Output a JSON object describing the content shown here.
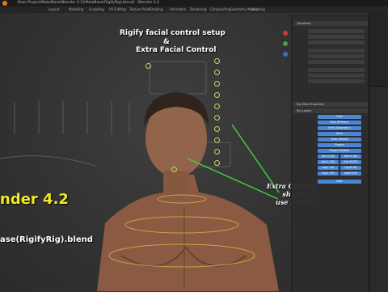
{
  "window": {
    "title": "Base Project/Male/Base(Blender 4.2)(MaleBase(RigifyRig).blend) - Blender 4.2"
  },
  "menu": {
    "items": [
      "Layout",
      "Modeling",
      "Sculpting",
      "UV Editing",
      "Texture Paint",
      "Shading",
      "Animation",
      "Rendering",
      "Compositing",
      "Geometry Nodes",
      "Scripting"
    ]
  },
  "overlay": {
    "heading_line1": "Rigify facial control setup",
    "heading_amp": "&",
    "heading_line2": "Extra Facial Control",
    "callout_line1": "Extra Customize Facial",
    "callout_line2": "shape control",
    "callout_line3": "use morph target",
    "version": "nder 4.2",
    "filename": "ase(RigifyRig).blend"
  },
  "colors": {
    "heading": "#ffffff",
    "version": "#f3ea1c",
    "callout_line": "#38d23c",
    "accent_button": "#4a86d4",
    "control_ring": "#d3cf62"
  },
  "npanel": {
    "section_transform": "Transform",
    "section_bone_props": "Rig Main Properties",
    "section_layers": "Rig Layers",
    "layer_buttons": [
      "Face",
      "Face (Primary)",
      "Face (Secondary)",
      "Torso",
      "Torso (Tweak)",
      "Fingers",
      "Fingers (Detail)",
      "Arm.L (IK)",
      "Arm.R (IK)",
      "Arm.L (FK)",
      "Arm.R (FK)",
      "Leg.L (IK)",
      "Leg.R (IK)",
      "Leg.L (FK)",
      "Leg.R (FK)",
      "Root"
    ]
  },
  "icons": [
    "gizmo-axis-icon",
    "zoom-icon",
    "hand-icon",
    "camera-icon",
    "grid-icon",
    "blender-logo-icon"
  ]
}
